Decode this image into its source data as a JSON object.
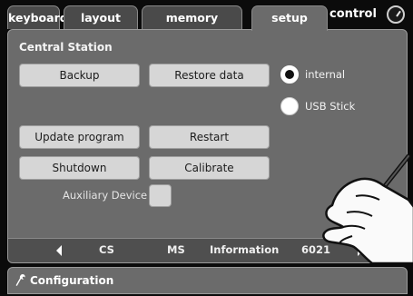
{
  "tabs": [
    {
      "label": "keyboard"
    },
    {
      "label": "layout"
    },
    {
      "label": "memory"
    },
    {
      "label": "setup"
    }
  ],
  "control": {
    "label": "control"
  },
  "section": {
    "title": "Central Station"
  },
  "buttons": {
    "backup": "Backup",
    "restore": "Restore data",
    "update": "Update program",
    "restart": "Restart",
    "shutdown": "Shutdown",
    "calibrate": "Calibrate"
  },
  "storage": {
    "internal": "internal",
    "usb": "USB Stick",
    "selected": "internal"
  },
  "aux": {
    "label": "Auxiliary Device"
  },
  "bottom": {
    "cs": "CS",
    "ms": "MS",
    "information": "Information",
    "value": "6021",
    "help": "?"
  },
  "config": {
    "label": "Configuration"
  },
  "icons": {
    "clock": "clock-icon",
    "wrench": "wrench-icon",
    "left": "chevron-left-icon",
    "right": "chevron-right-icon",
    "hand": "pointing-hand-stylus-icon"
  }
}
